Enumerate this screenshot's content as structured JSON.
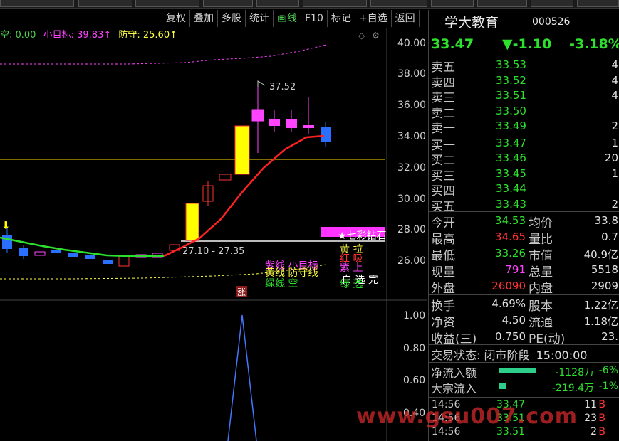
{
  "toolbar": {
    "items": [
      "复权",
      "叠加",
      "多股",
      "统计",
      "画线",
      "F10",
      "标记",
      "+自选",
      "返回"
    ],
    "active_index": 4
  },
  "indicator": {
    "part1": "空: 0.00",
    "part2": "小目标: 39.83↑",
    "part3": "防守: 25.60↑",
    "colors": [
      "#4fd14f",
      "#ff44ff",
      "#ffff44"
    ]
  },
  "price_axis": [
    "40.00",
    "38.00",
    "36.00",
    "34.00",
    "32.00",
    "30.00",
    "28.00",
    "26.00"
  ],
  "lower_axis": [
    "1.00",
    "0.80",
    "0.60",
    "0.40"
  ],
  "annotations": {
    "high_label": "37.52",
    "range_label": "27.10 - 27.35",
    "zhang": "涨",
    "arrow": "⬇"
  },
  "legend": {
    "l1": "紫线 小目标",
    "l2": "黄线 防守线",
    "l3": "绿线 空",
    "r1": "★七彩钻石",
    "r2": "黄 拉",
    "r3": "红 吸",
    "r4": "紫 上",
    "r5": "白 选 完",
    "r6": "绿 选"
  },
  "quote": {
    "name": "学大教育",
    "code": "000526",
    "price": "33.47",
    "change": "▼-1.10",
    "change_pct": "-3.18%"
  },
  "orderbook": [
    {
      "label": "卖五",
      "price": "33.53",
      "vol": "4"
    },
    {
      "label": "卖四",
      "price": "33.52",
      "vol": "4"
    },
    {
      "label": "卖三",
      "price": "33.51",
      "vol": "4"
    },
    {
      "label": "卖二",
      "price": "33.50",
      "vol": ""
    },
    {
      "label": "卖一",
      "price": "33.49",
      "vol": "2"
    },
    {
      "label": "买一",
      "price": "33.47",
      "vol": "1"
    },
    {
      "label": "买二",
      "price": "33.46",
      "vol": "20"
    },
    {
      "label": "买三",
      "price": "33.45",
      "vol": "1"
    },
    {
      "label": "买四",
      "price": "33.44",
      "vol": ""
    },
    {
      "label": "买五",
      "price": "33.43",
      "vol": "2"
    }
  ],
  "stats1": [
    {
      "k1": "今开",
      "v1": "34.53",
      "c1": "#2ee02e",
      "k2": "均价",
      "v2": "33.8"
    },
    {
      "k1": "最高",
      "v1": "34.65",
      "c1": "#ff3333",
      "k2": "量比",
      "v2": "0.7"
    },
    {
      "k1": "最低",
      "v1": "33.26",
      "c1": "#2ee02e",
      "k2": "市值",
      "v2": "40.9亿"
    },
    {
      "k1": "现量",
      "v1": "791",
      "c1": "#ff44ff",
      "k2": "总量",
      "v2": "5518"
    },
    {
      "k1": "外盘",
      "v1": "26090",
      "c1": "#ff3333",
      "k2": "内盘",
      "v2": "2909"
    }
  ],
  "stats2": [
    {
      "k1": "换手",
      "v1": "4.69%",
      "c1": "#e0e0e0",
      "k2": "股本",
      "v2": "1.22亿"
    },
    {
      "k1": "净资",
      "v1": "4.50",
      "c1": "#e0e0e0",
      "k2": "流通",
      "v2": "1.18亿"
    },
    {
      "k1": "收益(三)",
      "v1": "0.750",
      "c1": "#e0e0e0",
      "k2": "PE(动)",
      "v2": "23."
    }
  ],
  "status": {
    "label": "交易状态:",
    "value": "闭市阶段",
    "time": "15:00:00"
  },
  "flow": [
    {
      "label": "净流入额",
      "value": "-1128万",
      "pct": "-6%"
    },
    {
      "label": "大宗流入",
      "value": "-219.4万",
      "pct": "-1%"
    }
  ],
  "ticks": [
    {
      "time": "14:56",
      "price": "33.47",
      "vol": "11",
      "dir": "B"
    },
    {
      "time": "14:56",
      "price": "33.51",
      "vol": "23",
      "dir": "B"
    },
    {
      "time": "14:56",
      "price": "33.51",
      "vol": "2",
      "dir": "B"
    }
  ],
  "watermark": "www.gsu007.com",
  "colors": {
    "up": "#ff3333",
    "down": "#2ee02e",
    "bg": "#000000",
    "yellow": "#ffff44",
    "magenta": "#ff44ff"
  }
}
